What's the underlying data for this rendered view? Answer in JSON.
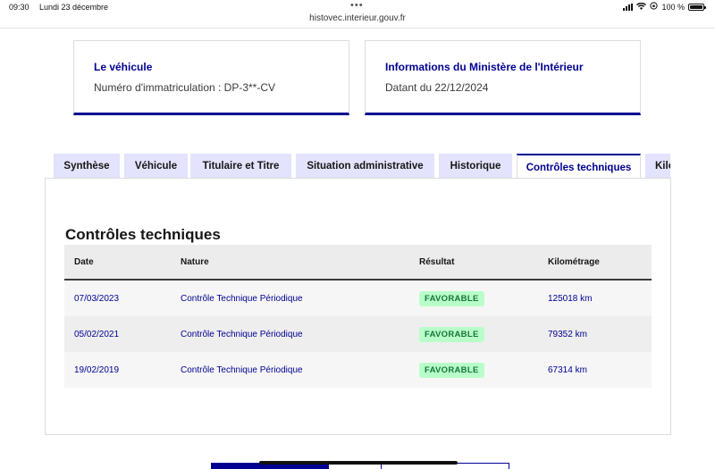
{
  "status": {
    "time": "09:30",
    "date": "Lundi 23 décembre",
    "battery": "100 %"
  },
  "browser": {
    "url": "histovec.interieur.gouv.fr"
  },
  "cards": [
    {
      "title": "Le véhicule",
      "text": "Numéro d'immatriculation : DP-3**-CV"
    },
    {
      "title": "Informations du Ministère de l'Intérieur",
      "text": "Datant du 22/12/2024"
    }
  ],
  "tabs": [
    {
      "label": "Synthèse"
    },
    {
      "label": "Véhicule"
    },
    {
      "label": "Titulaire et Titre"
    },
    {
      "label": "Situation administrative"
    },
    {
      "label": "Historique"
    },
    {
      "label": "Contrôles techniques"
    },
    {
      "label": "Kilométrage"
    }
  ],
  "section": {
    "title": "Contrôles techniques",
    "columns": [
      "Date",
      "Nature",
      "Résultat",
      "Kilométrage"
    ],
    "rows": [
      {
        "date": "07/03/2023",
        "nature": "Contrôle Technique Périodique",
        "result": "FAVORABLE",
        "km": "125018 km"
      },
      {
        "date": "05/02/2021",
        "nature": "Contrôle Technique Périodique",
        "result": "FAVORABLE",
        "km": "79352 km"
      },
      {
        "date": "19/02/2019",
        "nature": "Contrôle Technique Périodique",
        "result": "FAVORABLE",
        "km": "67314 km"
      }
    ]
  },
  "colors": {
    "primary": "#000091",
    "tab_bg": "#e3e3fd",
    "badge_bg": "#b8fec9",
    "badge_text": "#18753c"
  }
}
